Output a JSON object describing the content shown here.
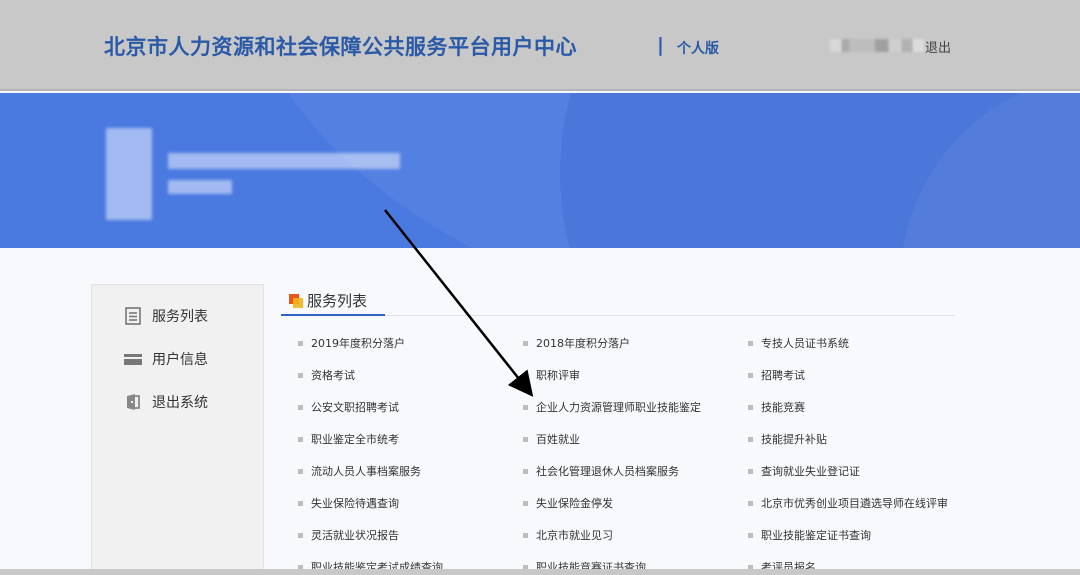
{
  "header": {
    "title": "北京市人力资源和社会保障公共服务平台用户中心",
    "separator": "|",
    "edition": "个人版",
    "logout": "退出"
  },
  "sidebar": {
    "items": [
      {
        "label": "服务列表",
        "icon": "list-icon"
      },
      {
        "label": "用户信息",
        "icon": "card-icon"
      },
      {
        "label": "退出系统",
        "icon": "logout-icon"
      }
    ]
  },
  "main": {
    "heading": "服务列表",
    "services": [
      [
        "2019年度积分落户",
        "2018年度积分落户",
        "专技人员证书系统"
      ],
      [
        "资格考试",
        "职称评审",
        "招聘考试"
      ],
      [
        "公安文职招聘考试",
        "企业人力资源管理师职业技能鉴定",
        "技能竞赛"
      ],
      [
        "职业鉴定全市统考",
        "百姓就业",
        "技能提升补贴"
      ],
      [
        "流动人员人事档案服务",
        "社会化管理退休人员档案服务",
        "查询就业失业登记证"
      ],
      [
        "失业保险待遇查询",
        "失业保险金停发",
        "北京市优秀创业项目遴选导师在线评审"
      ],
      [
        "灵活就业状况报告",
        "北京市就业见习",
        "职业技能鉴定证书查询"
      ],
      [
        "职业技能鉴定考试成绩查询",
        "职业技能竞赛证书查询",
        "考评员报名"
      ]
    ]
  },
  "colors": {
    "header_bg": "#c8c8c8",
    "title": "#2a5aa7",
    "banner": "#4a79e0",
    "accent_underline": "#2e62c8",
    "arrow": "#000000"
  }
}
